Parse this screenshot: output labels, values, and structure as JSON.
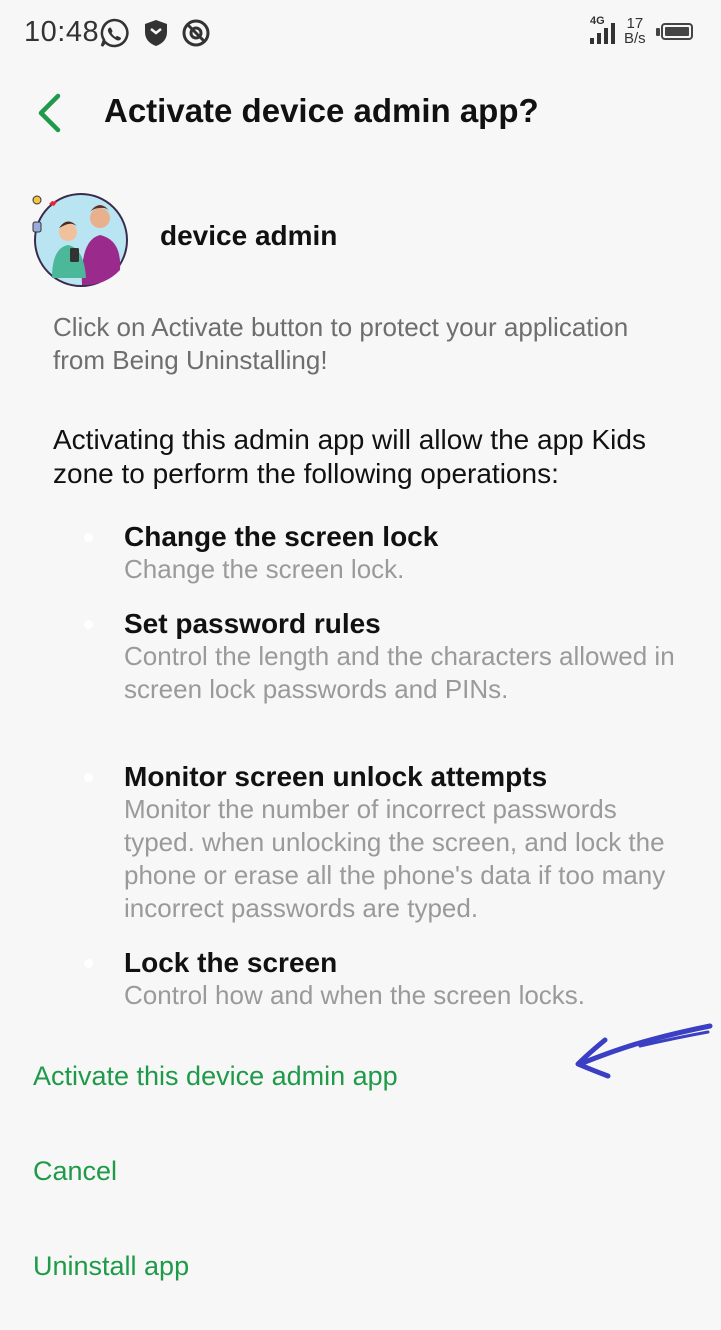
{
  "status_bar": {
    "time": "10:48",
    "network": "4G",
    "speed_value": "17",
    "speed_unit": "B/s"
  },
  "header": {
    "title": "Activate device admin app?"
  },
  "app": {
    "name": "device admin",
    "description": "Click on Activate button to protect your application from Being Uninstalling!"
  },
  "intro": "Activating this admin app will allow the app Kids zone to perform the following operations:",
  "permissions": [
    {
      "title": "Change the screen lock",
      "description": "Change the screen lock."
    },
    {
      "title": "Set password rules",
      "description": "Control the length and the characters allowed in screen lock passwords and PINs."
    },
    {
      "title": "Monitor screen unlock attempts",
      "description": "Monitor the number of incorrect passwords typed. when unlocking the screen, and lock the phone or erase all the phone's data if too many incorrect passwords are typed."
    },
    {
      "title": "Lock the screen",
      "description": "Control how and when the screen locks."
    }
  ],
  "actions": {
    "activate": "Activate this device admin app",
    "cancel": "Cancel",
    "uninstall": "Uninstall app"
  },
  "colors": {
    "accent": "#1e9a49",
    "annotation_arrow": "#3a3fc4"
  },
  "icons": [
    "whatsapp-icon",
    "shield-icon",
    "blocked-icon",
    "signal-icon",
    "battery-icon",
    "back-arrow-icon"
  ]
}
